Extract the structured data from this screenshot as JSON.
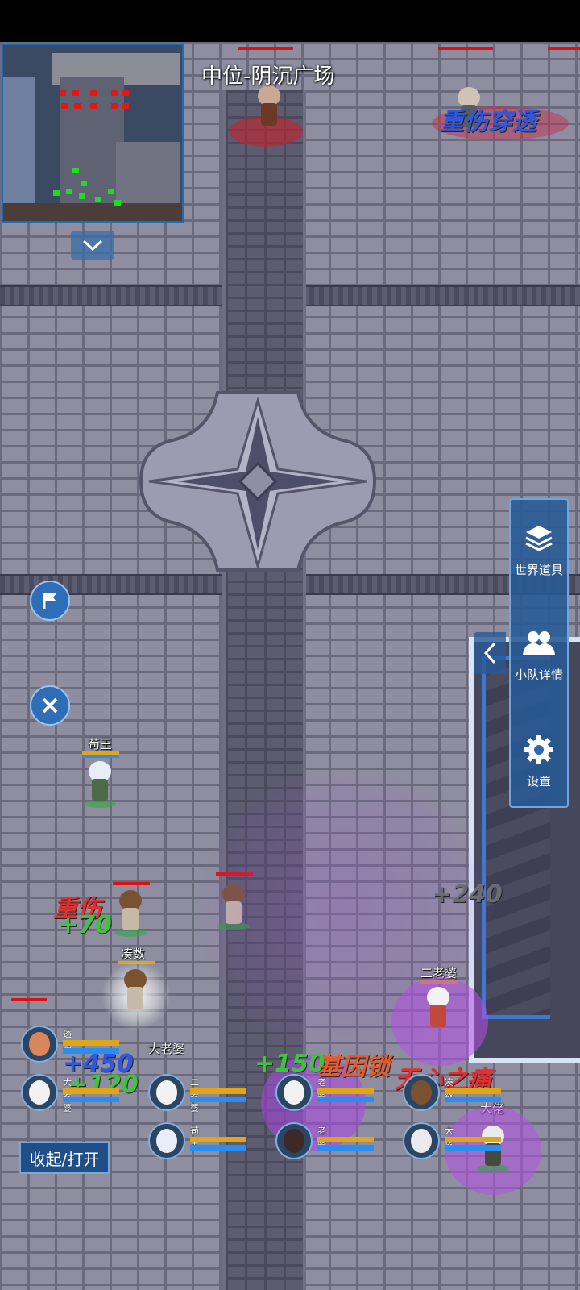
{
  "location_title": "中位-阴沉广场",
  "side_menu": {
    "world_items_label": "世界道具",
    "team_details_label": "小队详情",
    "settings_label": "设置"
  },
  "collapse_button_label": "收起/打开",
  "map_characters": [
    {
      "name": "苟王"
    },
    {
      "name": "凑数"
    },
    {
      "name": "二老婆"
    },
    {
      "name": "大老婆"
    },
    {
      "name": "大佬"
    }
  ],
  "combat_text": {
    "injured": "重伤",
    "heal_70": "+70",
    "dmg_240": "+240",
    "heal_450": "+450",
    "heal_120": "+120",
    "heal_150": "+150",
    "gene_lock": "基因锁",
    "no_heart": "无心之痛",
    "wound_pierce": "重伤穿透"
  },
  "party": [
    {
      "name": "透明"
    },
    {
      "name": "大老婆"
    },
    {
      "name": "二老婆"
    },
    {
      "name": "苟王"
    },
    {
      "name": "老婆"
    },
    {
      "name": "老婆"
    },
    {
      "name": "凑数"
    },
    {
      "name": "大佬"
    }
  ],
  "colors": {
    "ui_blue": "#2e6db8",
    "hp_red": "#d11111",
    "ally_green": "#28aa3c",
    "mana_blue": "#2a8df0",
    "stamina_gold": "#e0a617",
    "aura_purple": "#b04ee0"
  },
  "icons": [
    "flag-icon",
    "close-icon",
    "chevron-down-icon",
    "chevron-left-icon",
    "layers-icon",
    "people-icon",
    "gear-icon"
  ]
}
